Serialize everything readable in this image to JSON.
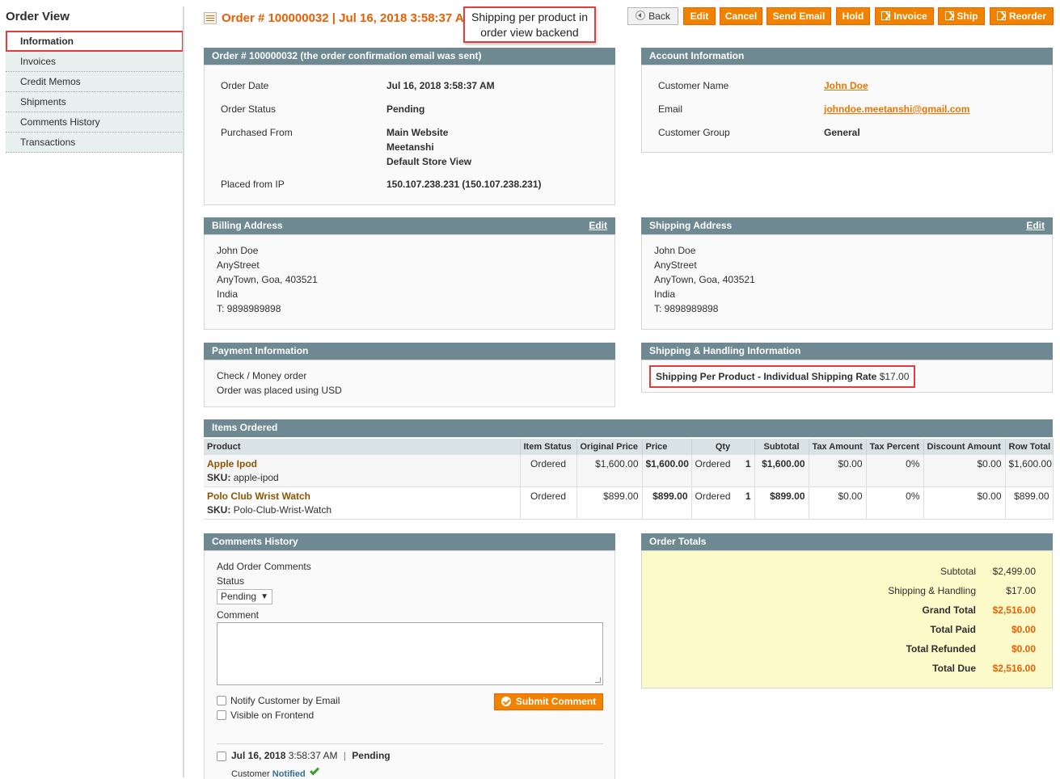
{
  "sidebar": {
    "title": "Order View",
    "items": [
      {
        "label": "Information"
      },
      {
        "label": "Invoices"
      },
      {
        "label": "Credit Memos"
      },
      {
        "label": "Shipments"
      },
      {
        "label": "Comments History"
      },
      {
        "label": "Transactions"
      }
    ]
  },
  "header": {
    "title": "Order # 100000032 | Jul 16, 2018 3:58:37 AM",
    "callout": "Shipping per product in order view backend",
    "buttons": {
      "back": "Back",
      "edit": "Edit",
      "cancel": "Cancel",
      "send_email": "Send Email",
      "hold": "Hold",
      "invoice": "Invoice",
      "ship": "Ship",
      "reorder": "Reorder"
    }
  },
  "order_info": {
    "heading": "Order # 100000032 (the order confirmation email was sent)",
    "order_date_label": "Order Date",
    "order_date": "Jul 16, 2018 3:58:37 AM",
    "status_label": "Order Status",
    "status": "Pending",
    "purchased_label": "Purchased From",
    "purchased_from": [
      "Main Website",
      "Meetanshi",
      "Default Store View"
    ],
    "ip_label": "Placed from IP",
    "ip": "150.107.238.231 (150.107.238.231)"
  },
  "account_info": {
    "heading": "Account Information",
    "name_label": "Customer Name",
    "name": "John Doe",
    "email_label": "Email",
    "email": "johndoe.meetanshi@gmail.com",
    "group_label": "Customer Group",
    "group": "General"
  },
  "billing": {
    "heading": "Billing Address",
    "edit": "Edit",
    "lines": [
      "John Doe",
      "AnyStreet",
      "AnyTown, Goa, 403521",
      "India",
      "T: 9898989898"
    ]
  },
  "shipping": {
    "heading": "Shipping Address",
    "edit": "Edit",
    "lines": [
      "John Doe",
      "AnyStreet",
      "AnyTown, Goa, 403521",
      "India",
      "T: 9898989898"
    ]
  },
  "payment": {
    "heading": "Payment Information",
    "method": "Check / Money order",
    "currency_note": "Order was placed using USD"
  },
  "shipping_handling": {
    "heading": "Shipping & Handling Information",
    "method": "Shipping Per Product - Individual Shipping Rate",
    "amount": "$17.00"
  },
  "items": {
    "heading": "Items Ordered",
    "columns": [
      "Product",
      "Item Status",
      "Original Price",
      "Price",
      "Qty",
      "Subtotal",
      "Tax Amount",
      "Tax Percent",
      "Discount Amount",
      "Row Total"
    ],
    "sku_label": "SKU:",
    "rows": [
      {
        "name": "Apple Ipod",
        "sku": "apple-ipod",
        "status": "Ordered",
        "original_price": "$1,600.00",
        "price": "$1,600.00",
        "qty_label": "Ordered",
        "qty": "1",
        "subtotal": "$1,600.00",
        "tax_amount": "$0.00",
        "tax_percent": "0%",
        "discount": "$0.00",
        "row_total": "$1,600.00"
      },
      {
        "name": "Polo Club Wrist Watch",
        "sku": "Polo-Club-Wrist-Watch",
        "status": "Ordered",
        "original_price": "$899.00",
        "price": "$899.00",
        "qty_label": "Ordered",
        "qty": "1",
        "subtotal": "$899.00",
        "tax_amount": "$0.00",
        "tax_percent": "0%",
        "discount": "$0.00",
        "row_total": "$899.00"
      }
    ]
  },
  "comments": {
    "heading": "Comments History",
    "add_label": "Add Order Comments",
    "status_label": "Status",
    "status_value": "Pending",
    "comment_label": "Comment",
    "notify_label": "Notify Customer by Email",
    "visible_label": "Visible on Frontend",
    "submit_label": "Submit Comment",
    "history": {
      "date": "Jul 16, 2018",
      "time": "3:58:37 AM",
      "separator": "|",
      "status": "Pending",
      "customer_label": "Customer",
      "notified_label": "Notified"
    }
  },
  "totals": {
    "heading": "Order Totals",
    "subtotal_label": "Subtotal",
    "subtotal": "$2,499.00",
    "shipping_label": "Shipping & Handling",
    "shipping": "$17.00",
    "grand_label": "Grand Total",
    "grand": "$2,516.00",
    "paid_label": "Total Paid",
    "paid": "$0.00",
    "refunded_label": "Total Refunded",
    "refunded": "$0.00",
    "due_label": "Total Due",
    "due": "$2,516.00"
  },
  "colors": {
    "accent": "#eb5e00",
    "button": "#f18200",
    "box_header": "#6f8992",
    "highlight_border": "#e03e3e",
    "totals_bg": "#fbfac8"
  }
}
